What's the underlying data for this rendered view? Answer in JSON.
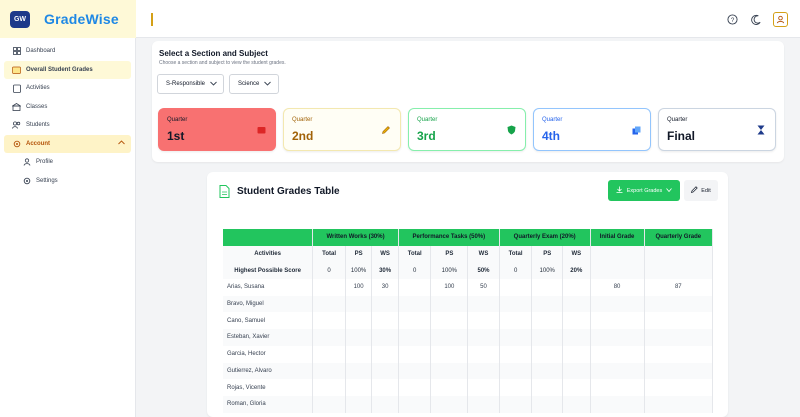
{
  "brand": {
    "logo_text": "GW",
    "name": "GradeWise"
  },
  "sidebar": {
    "items": [
      {
        "label": "Dashboard",
        "icon": "grid-icon"
      },
      {
        "label": "Overall Student Grades",
        "icon": "folder-icon"
      },
      {
        "label": "Activities",
        "icon": "clipboard-icon"
      },
      {
        "label": "Classes",
        "icon": "building-icon"
      },
      {
        "label": "Students",
        "icon": "users-icon"
      },
      {
        "label": "Account",
        "icon": "gear-icon"
      },
      {
        "label": "Profile",
        "icon": "user-icon"
      },
      {
        "label": "Settings",
        "icon": "gear-icon"
      }
    ]
  },
  "section": {
    "title": "Select a Section and Subject",
    "subtitle": "Choose a section and subject to view the student grades.",
    "section_select": "S-Responsible",
    "subject_select": "Science"
  },
  "quarters": [
    {
      "label": "Quarter",
      "value": "1st",
      "color": "#f87171"
    },
    {
      "label": "Quarter",
      "value": "2nd",
      "color": "#a16207"
    },
    {
      "label": "Quarter",
      "value": "3rd",
      "color": "#16a34a"
    },
    {
      "label": "Quarter",
      "value": "4th",
      "color": "#2563eb"
    },
    {
      "label": "Quarter",
      "value": "Final",
      "color": "#111827"
    }
  ],
  "grades": {
    "title": "Student Grades Table",
    "export_label": "Export Grades",
    "edit_label": "Edit",
    "group_headers": [
      "Written Works (30%)",
      "Performance Tasks (50%)",
      "Quarterly Exam (20%)",
      "Initial Grade",
      "Quarterly Grade"
    ],
    "activities_label": "Activities",
    "sub_headers": [
      "Total",
      "PS",
      "WS",
      "Total",
      "PS",
      "WS",
      "Total",
      "PS",
      "WS"
    ],
    "highest_label": "Highest Possible Score",
    "highest": [
      "0",
      "100%",
      "30%",
      "0",
      "100%",
      "50%",
      "0",
      "100%",
      "20%"
    ],
    "students": [
      {
        "name": "Arias, Susana",
        "cells": [
          "",
          "100",
          "30",
          "",
          "100",
          "50",
          "",
          "",
          "",
          "80",
          "87"
        ]
      },
      {
        "name": "Bravo, Miguel",
        "cells": [
          "",
          "",
          "",
          "",
          "",
          "",
          "",
          "",
          "",
          "",
          ""
        ]
      },
      {
        "name": "Cano, Samuel",
        "cells": [
          "",
          "",
          "",
          "",
          "",
          "",
          "",
          "",
          "",
          "",
          ""
        ]
      },
      {
        "name": "Esteban, Xavier",
        "cells": [
          "",
          "",
          "",
          "",
          "",
          "",
          "",
          "",
          "",
          "",
          ""
        ]
      },
      {
        "name": "Garcia, Hector",
        "cells": [
          "",
          "",
          "",
          "",
          "",
          "",
          "",
          "",
          "",
          "",
          ""
        ]
      },
      {
        "name": "Gutierrez, Alvaro",
        "cells": [
          "",
          "",
          "",
          "",
          "",
          "",
          "",
          "",
          "",
          "",
          ""
        ]
      },
      {
        "name": "Rojas, Vicente",
        "cells": [
          "",
          "",
          "",
          "",
          "",
          "",
          "",
          "",
          "",
          "",
          ""
        ]
      },
      {
        "name": "Roman, Gloria",
        "cells": [
          "",
          "",
          "",
          "",
          "",
          "",
          "",
          "",
          "",
          "",
          ""
        ]
      }
    ]
  },
  "colors": {
    "accent_green": "#22c55e",
    "brand_blue": "#1e88e5",
    "sidebar_highlight": "#fef9d7"
  }
}
